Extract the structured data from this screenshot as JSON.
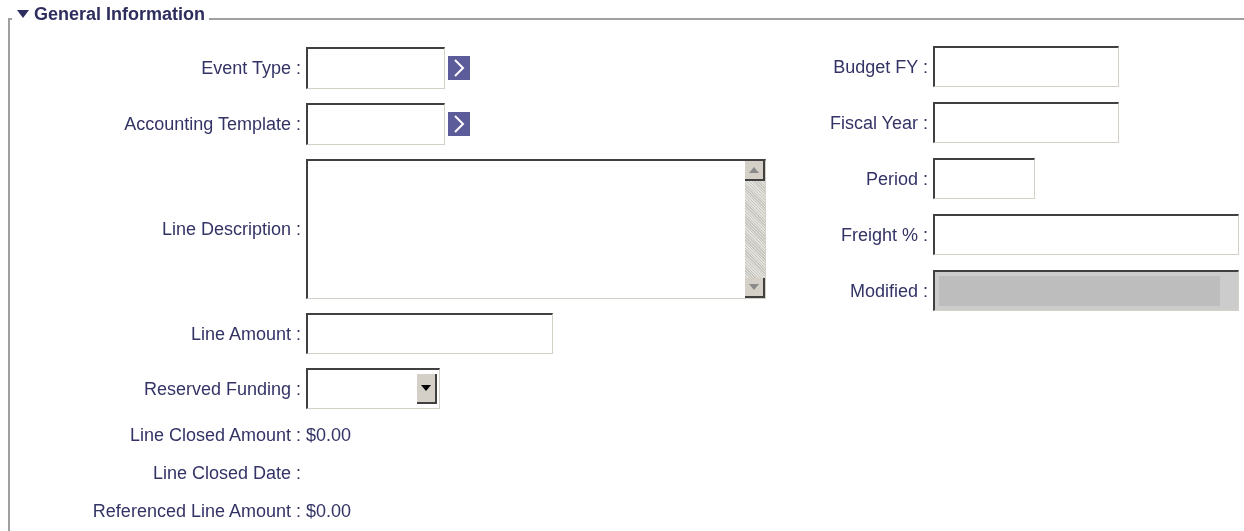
{
  "section": {
    "title": "General Information",
    "expanded": true
  },
  "left_fields": [
    {
      "label": "Event Type :",
      "kind": "lookup"
    },
    {
      "label": "Accounting Template :",
      "kind": "lookup"
    },
    {
      "label": "Line Description :",
      "kind": "textarea"
    },
    {
      "label": "Line Amount :",
      "kind": "text"
    },
    {
      "label": "Reserved Funding :",
      "kind": "select"
    },
    {
      "label": "Line Closed Amount :",
      "kind": "readonly",
      "value": "$0.00"
    },
    {
      "label": "Line Closed Date :",
      "kind": "readonly"
    },
    {
      "label": "Referenced Line Amount :",
      "kind": "readonly",
      "value": "$0.00"
    }
  ],
  "right_fields": [
    {
      "label": "Budget FY :",
      "kind": "text"
    },
    {
      "label": "Fiscal Year :",
      "kind": "text"
    },
    {
      "label": "Period :",
      "kind": "text"
    },
    {
      "label": "Freight % :",
      "kind": "text"
    },
    {
      "label": "Modified :",
      "kind": "disabled"
    }
  ]
}
